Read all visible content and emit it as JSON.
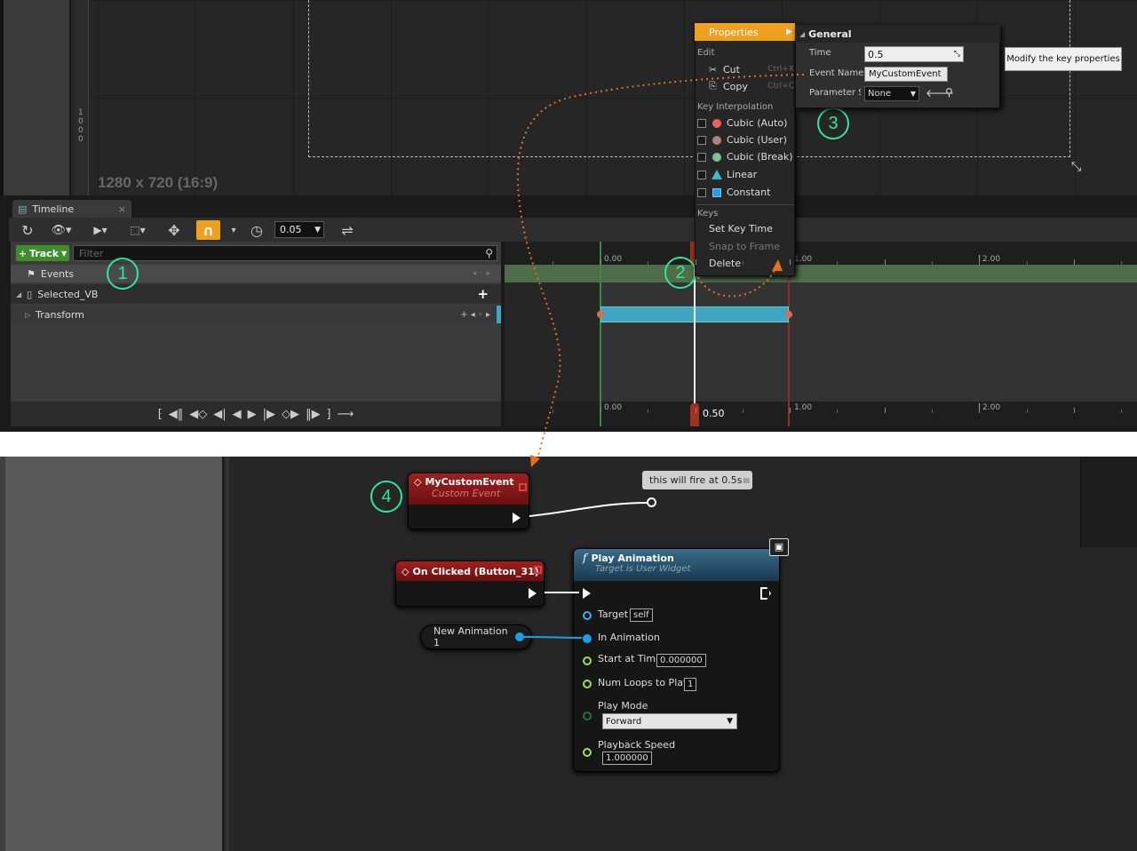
{
  "viewport": {
    "resolution_label": "1280 x 720 (16:9)",
    "scale_digits": "1\n0\n0\n0"
  },
  "timeline_tab": {
    "title": "Timeline",
    "close": "×"
  },
  "toolbar": {
    "snap_value": "0.05"
  },
  "track_panel": {
    "add_track_label": "Track",
    "filter_placeholder": "Filter",
    "rows": [
      {
        "label": "Events",
        "controls": "◂ ◦ ▸"
      },
      {
        "label": "Selected_VB",
        "controls": "+"
      },
      {
        "label": "Transform",
        "controls": "+  ◂ ◦ ▸"
      }
    ]
  },
  "ruler": {
    "top_labels": [
      "0.00",
      "1.00",
      "2.00"
    ],
    "bottom_labels": [
      "0.00",
      "1.00",
      "2.00"
    ],
    "playhead_value": "0.50"
  },
  "context_menu": {
    "properties_label": "Properties",
    "edit_header": "Edit",
    "cut_label": "Cut",
    "cut_shortcut": "Ctrl+X",
    "copy_label": "Copy",
    "copy_shortcut": "Ctrl+C",
    "interp_header": "Key Interpolation",
    "interp_items": [
      "Cubic (Auto)",
      "Cubic (User)",
      "Cubic (Break)",
      "Linear",
      "Constant"
    ],
    "keys_header": "Keys",
    "set_key_time": "Set Key Time",
    "snap_to_frame": "Snap to Frame",
    "delete": "Delete"
  },
  "properties_panel": {
    "header": "General",
    "time_label": "Time",
    "time_value": "0.5",
    "event_name_label": "Event Name",
    "event_name_value": "MyCustomEvent",
    "parameter_label": "Parameter S",
    "parameter_value": "None"
  },
  "tooltip": {
    "text": "Modify the key properties"
  },
  "callouts": [
    "1",
    "2",
    "3",
    "4"
  ],
  "graph": {
    "custom_event": {
      "title": "MyCustomEvent",
      "subtitle": "Custom Event"
    },
    "comment_bubble": "this will fire at 0.5s",
    "on_clicked": {
      "title": "On Clicked (Button_31)"
    },
    "new_animation": "New Animation 1",
    "play_animation": {
      "title": "Play Animation",
      "subtitle": "Target is User Widget",
      "target_label": "Target",
      "target_value": "self",
      "in_animation_label": "In Animation",
      "start_time_label": "Start at Time",
      "start_time_value": "0.000000",
      "loops_label": "Num Loops to Play",
      "loops_value": "1",
      "play_mode_label": "Play Mode",
      "play_mode_value": "Forward",
      "speed_label": "Playback Speed",
      "speed_value": "1.000000"
    }
  },
  "colors": {
    "accent_orange": "#f0a020",
    "callout_green": "#2ee89a",
    "event_red": "#8b1a1a",
    "function_blue": "#2e5a78",
    "track_teal": "#3fa5c0",
    "arrow_orange": "#e8701a"
  }
}
